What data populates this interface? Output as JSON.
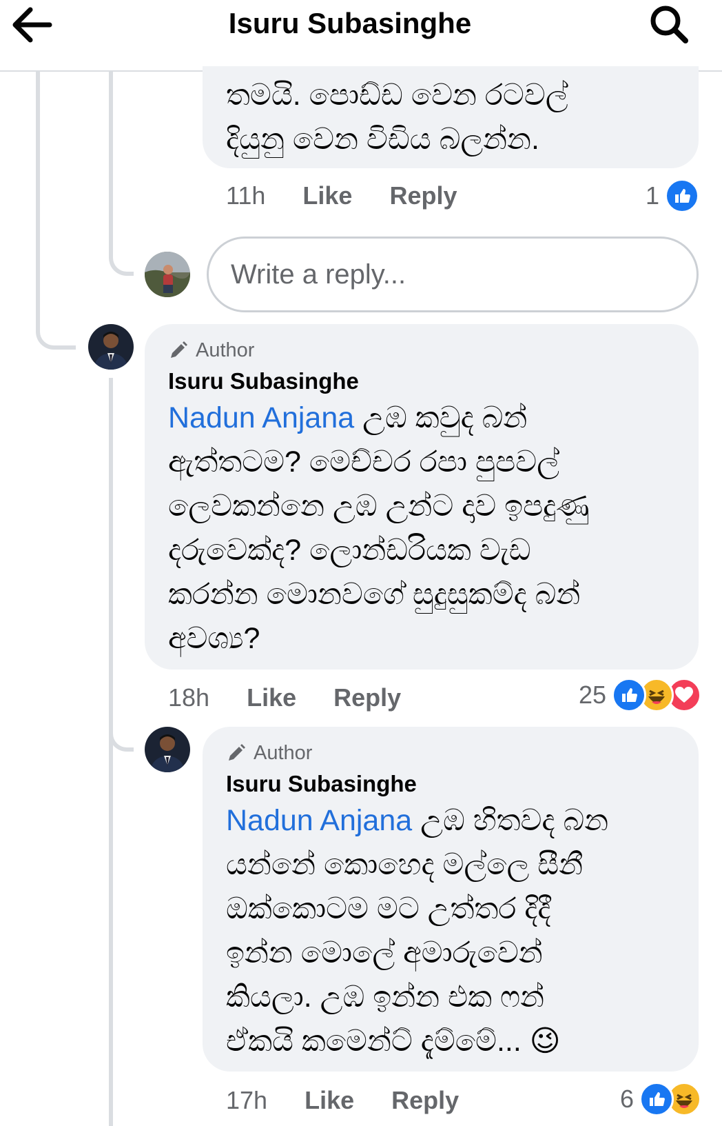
{
  "header": {
    "title": "Isuru Subasinghe",
    "back_icon": "arrow-left-icon",
    "search_icon": "search-icon"
  },
  "comments": [
    {
      "text_lines": [
        "තමයි. පොඩ්ඩ වෙන රටවල්",
        "දියුනු වෙන විඩිය බලන්න."
      ],
      "time": "11h",
      "like_label": "Like",
      "reply_label": "Reply",
      "reaction_count": "1",
      "reactions": [
        "like"
      ]
    },
    {
      "badge": "Author",
      "author": "Isuru Subasinghe",
      "mention": "Nadun Anjana",
      "text_first": " උඹ කවුද බන්",
      "text_lines": [
        "ඇත්තටම? මෙච්චර රපා පුපවල්",
        "ලෙවකන්නෙ උඹ උන්ට දාව ඉපදුණු",
        "දරුවෙක්ද? ලොන්ඩරියක වැඩ",
        "කරන්න මොනවගේ සුදුසුකම්ද බන්",
        "අවශ්‍ය?"
      ],
      "time": "18h",
      "like_label": "Like",
      "reply_label": "Reply",
      "reaction_count": "25",
      "reactions": [
        "like",
        "haha",
        "love"
      ]
    },
    {
      "badge": "Author",
      "author": "Isuru Subasinghe",
      "mention": "Nadun Anjana",
      "text_first": " උඹ හිතවද බන",
      "text_lines": [
        "යන්නේ කොහෙද මල්ලෙ සීනී",
        "ඔක්කොටම මට උත්තර දිදී",
        "ඉන්න මොලේ අමාරුවෙන්",
        "කියලා. උඹ ඉන්න එක ෆන්",
        "ඒකයි කමෙන්ට් දැම්මේ... 😉"
      ],
      "time": "17h",
      "like_label": "Like",
      "reply_label": "Reply",
      "reaction_count": "6",
      "reactions": [
        "like",
        "haha"
      ]
    }
  ],
  "reply_box": {
    "placeholder": "Write a reply..."
  },
  "colors": {
    "like": "#1877f2",
    "haha": "#f7b928",
    "love": "#f33e58",
    "mention": "#216fdb",
    "bubble": "#f0f2f5"
  }
}
